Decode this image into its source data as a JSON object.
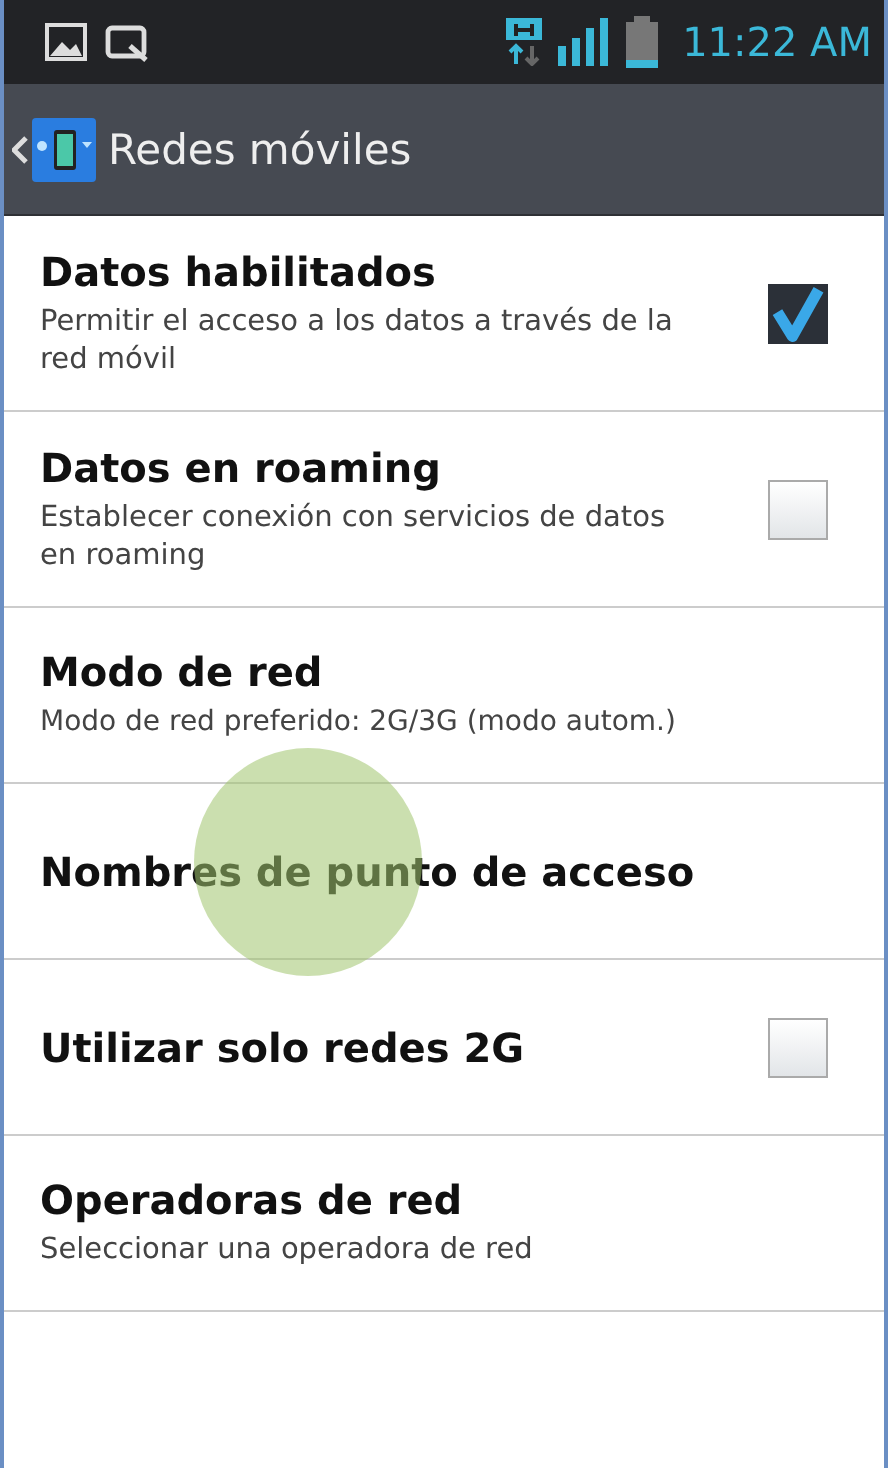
{
  "status_bar": {
    "time": "11:22 AM"
  },
  "action_bar": {
    "title": "Redes móviles"
  },
  "items": [
    {
      "kind": "checkbox",
      "title": "Datos habilitados",
      "summary": "Permitir el acceso a los datos a través de la red móvil",
      "checked": true
    },
    {
      "kind": "checkbox",
      "title": "Datos en roaming",
      "summary": "Establecer conexión con servicios de datos en roaming",
      "checked": false
    },
    {
      "kind": "plain",
      "title": "Modo de red",
      "summary": "Modo de red preferido: 2G/3G (modo autom.)"
    },
    {
      "kind": "plain",
      "title": "Nombres de punto de acceso"
    },
    {
      "kind": "checkbox",
      "title": "Utilizar solo redes 2G",
      "checked": false
    },
    {
      "kind": "plain",
      "title": "Operadoras de red",
      "summary": "Seleccionar una operadora de red"
    }
  ]
}
